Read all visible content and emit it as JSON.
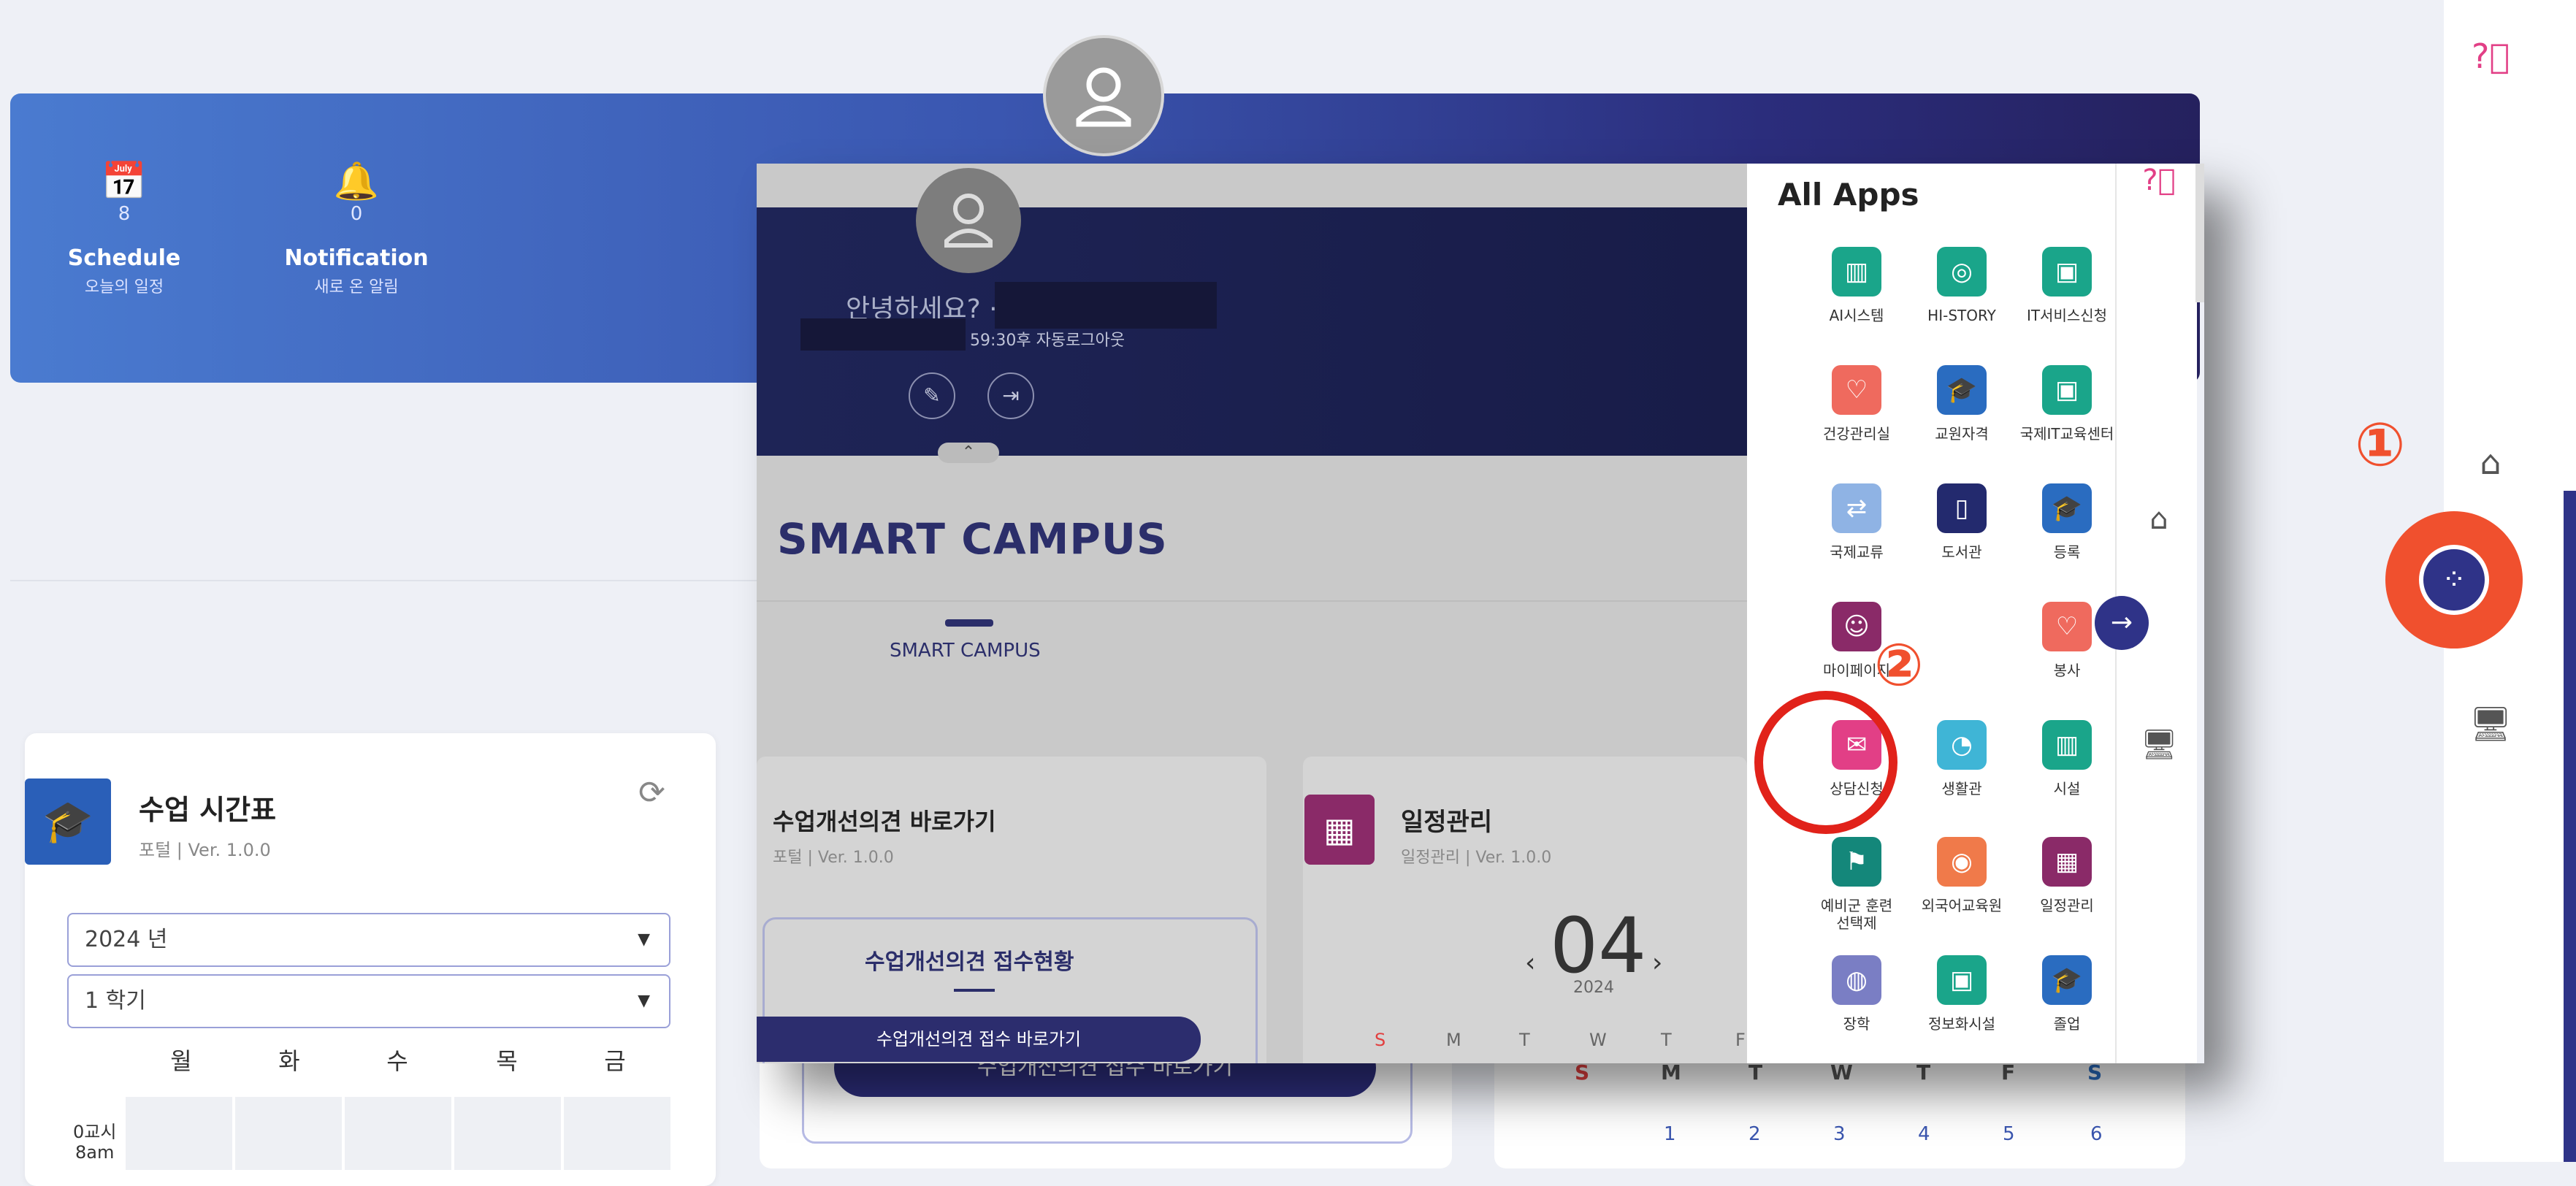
{
  "header": {
    "schedule": {
      "icon": "calendar-icon",
      "count": "8",
      "title": "Schedule",
      "subtitle": "오늘의 일정"
    },
    "notification": {
      "icon": "bell-icon",
      "count": "0",
      "title": "Notification",
      "subtitle": "새로 온 알림"
    }
  },
  "timetable": {
    "title": "수업 시간표",
    "subtitle": "포털 | Ver. 1.0.0",
    "year_select": "2024 년",
    "term_select": "1 학기",
    "days": [
      "월",
      "화",
      "수",
      "목",
      "금"
    ],
    "period_label": "0교시",
    "period_time": "8am"
  },
  "behind_cards": {
    "mid_button": "수업개선의견 접수 바로가기",
    "calendar_weekdays": [
      "S",
      "M",
      "T",
      "W",
      "T",
      "F",
      "S"
    ],
    "calendar_days": [
      "1",
      "2",
      "3",
      "4",
      "5",
      "6"
    ]
  },
  "overlay": {
    "greeting": "안녕하세요? ·",
    "timer": "59:30후 자동로그아웃",
    "smart_campus": "SMART CAMPUS",
    "tab": "SMART CAMPUS",
    "card1": {
      "title": "수업개선의견 바로가기",
      "subtitle": "포털 | Ver. 1.0.0",
      "box_title": "수업개선의견 접수현황",
      "button": "수업개선의견 접수 바로가기"
    },
    "card2": {
      "title": "일정관리",
      "subtitle": "일정관리 | Ver. 1.0.0",
      "month": "04",
      "year": "2024",
      "weekdays": [
        "S",
        "M",
        "T",
        "W",
        "T",
        "F"
      ]
    }
  },
  "apps_panel": {
    "title": "All Apps",
    "apps": [
      {
        "label": "AI시스템",
        "color": "#1aa58a",
        "icon": "books-icon"
      },
      {
        "label": "HI-STORY",
        "color": "#1aa58a",
        "icon": "lightbulb-icon"
      },
      {
        "label": "IT서비스신청",
        "color": "#1aa58a",
        "icon": "monitor-icon"
      },
      {
        "label": "건강관리실",
        "color": "#ef6a5e",
        "icon": "heart-icon"
      },
      {
        "label": "교원자격",
        "color": "#2a6cc0",
        "icon": "graduation-cap-icon"
      },
      {
        "label": "국제IT교육센터",
        "color": "#1aa58a",
        "icon": "monitor-icon"
      },
      {
        "label": "국제교류",
        "color": "#8fb3e4",
        "icon": "exchange-icon"
      },
      {
        "label": "도서관",
        "color": "#232a6e",
        "icon": "book-icon"
      },
      {
        "label": "등록",
        "color": "#2a6cc0",
        "icon": "graduation-cap-icon"
      },
      {
        "label": "마이페이지",
        "color": "#8a2a68",
        "icon": "person-icon"
      },
      {
        "label": "봉사",
        "color": "#ef6a5e",
        "icon": "heart-icon"
      },
      {
        "label": "상담신청",
        "color": "#e23f86",
        "icon": "chat-icon"
      },
      {
        "label": "생활관",
        "color": "#3fb5d6",
        "icon": "clock-icon"
      },
      {
        "label": "시설",
        "color": "#1aa58a",
        "icon": "books-icon"
      },
      {
        "label": "예비군 훈련 선택제",
        "color": "#14877a",
        "icon": "flag-icon"
      },
      {
        "label": "외국어교육원",
        "color": "#f07a4a",
        "icon": "target-icon"
      },
      {
        "label": "일정관리",
        "color": "#8a2a68",
        "icon": "calendar-icon"
      },
      {
        "label": "장학",
        "color": "#7a7ec4",
        "icon": "coin-icon"
      },
      {
        "label": "정보화시설",
        "color": "#1aa58a",
        "icon": "monitor-icon"
      },
      {
        "label": "졸업",
        "color": "#2a6cc0",
        "icon": "graduation-cap-icon"
      }
    ]
  },
  "annotations": {
    "step1": "①",
    "step2": "②"
  },
  "colors": {
    "accent": "#2f3388",
    "highlight": "#f0502e",
    "header_start": "#4a7bd0",
    "header_end": "#25215e"
  }
}
